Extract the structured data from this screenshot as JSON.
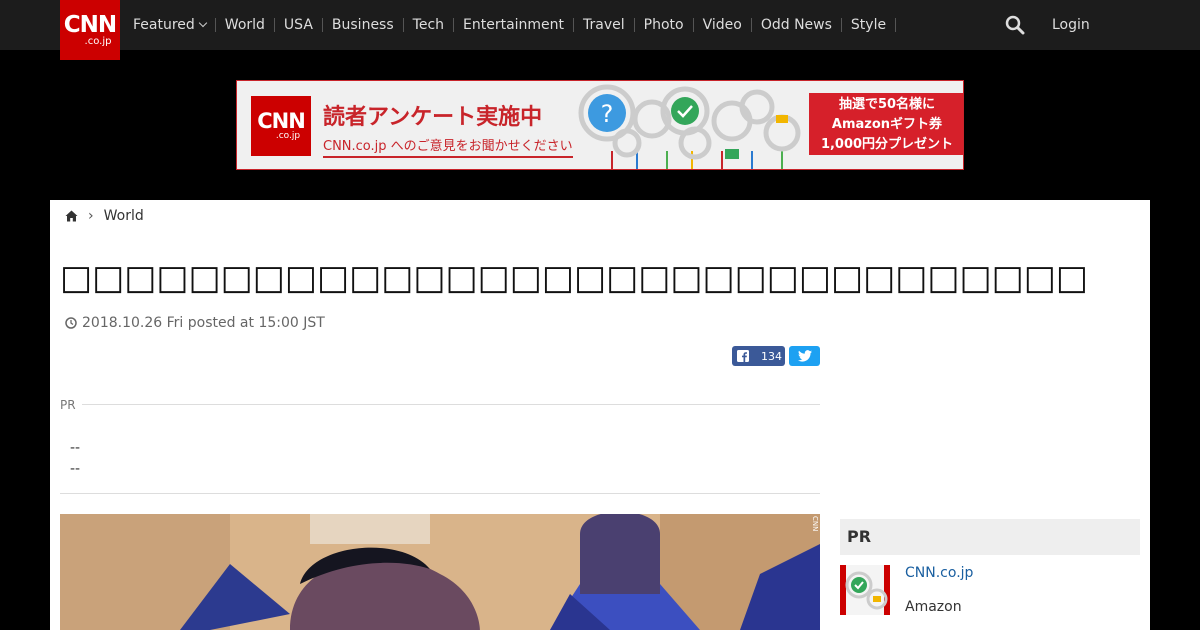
{
  "brand": {
    "logo_text": "CNN",
    "logo_sub": ".co.jp"
  },
  "nav": {
    "items": [
      {
        "label": "Featured"
      },
      {
        "label": "World"
      },
      {
        "label": "USA"
      },
      {
        "label": "Business"
      },
      {
        "label": "Tech"
      },
      {
        "label": "Entertainment"
      },
      {
        "label": "Travel"
      },
      {
        "label": "Photo"
      },
      {
        "label": "Video"
      },
      {
        "label": "Odd News"
      },
      {
        "label": "Style"
      }
    ],
    "login_label": "Login"
  },
  "banner": {
    "logo_text": "CNN",
    "logo_sub": ".co.jp",
    "title": "読者アンケート実施中",
    "subtitle": "CNN.co.jp へのご意見をお聞かせください",
    "right_line1": "抽選で50名様に",
    "right_line2": "Amazonギフト券",
    "right_line3": "1,000円分プレゼント"
  },
  "breadcrumb": {
    "current": "World"
  },
  "article": {
    "title": "□□□□□□□□□□□□□□□□□□□□□□□□□□□□□□□□",
    "dateline": "2018.10.26 Fri posted at 15:00 JST",
    "fb_count": "134",
    "pr_label": "PR",
    "pr_line1": "--",
    "pr_line2": "--"
  },
  "sidebar": {
    "pr_heading": "PR",
    "item_link": "CNN.co.jp",
    "item_text": "Amazon"
  },
  "colors": {
    "accent": "#cc0000",
    "nav_bg": "#1c1c1c",
    "facebook": "#3b5998",
    "twitter": "#1da1f2"
  }
}
